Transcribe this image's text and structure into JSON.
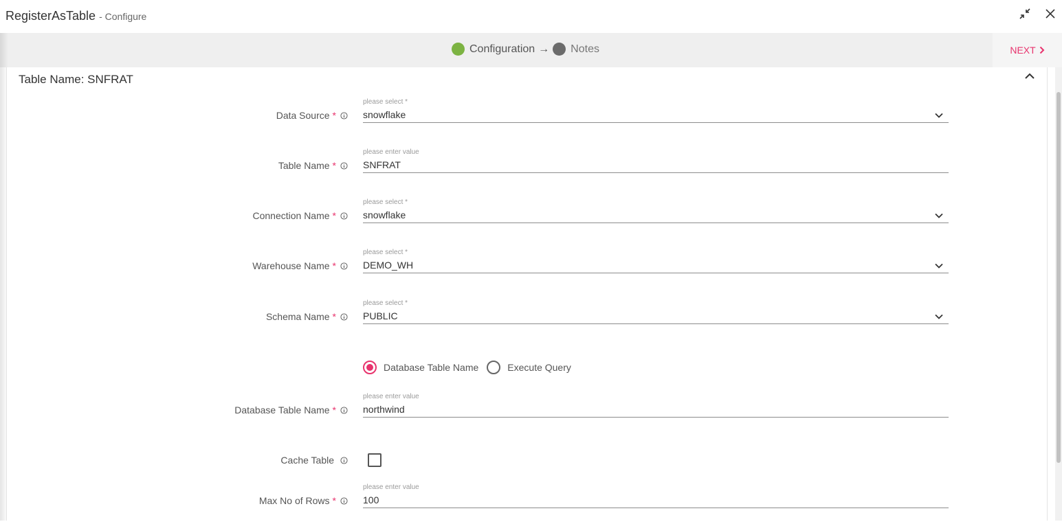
{
  "window": {
    "title": "RegisterAsTable",
    "subtitle": "- Configure"
  },
  "stepper": {
    "steps": [
      {
        "label": "Configuration",
        "status": "active",
        "color": "#7cb342"
      },
      {
        "label": "Notes",
        "status": "pending",
        "color": "#6b6b6b"
      }
    ],
    "arrow": "→",
    "next_label": "NEXT"
  },
  "panel": {
    "title": "Table Name: SNFRAT"
  },
  "form": {
    "data_source": {
      "label": "Data Source",
      "required": "*",
      "hint": "please select *",
      "value": "snowflake"
    },
    "table_name": {
      "label": "Table Name",
      "required": "*",
      "hint": "please enter value",
      "value": "SNFRAT"
    },
    "connection_name": {
      "label": "Connection Name",
      "required": "*",
      "hint": "please select *",
      "value": "snowflake"
    },
    "warehouse_name": {
      "label": "Warehouse Name",
      "required": "*",
      "hint": "please select *",
      "value": "DEMO_WH"
    },
    "schema_name": {
      "label": "Schema Name",
      "required": "*",
      "hint": "please select *",
      "value": "PUBLIC"
    },
    "source_type": {
      "options": [
        {
          "label": "Database Table Name",
          "selected": true
        },
        {
          "label": "Execute Query",
          "selected": false
        }
      ]
    },
    "database_table_name": {
      "label": "Database Table Name",
      "required": "*",
      "hint": "please enter value",
      "value": "northwind"
    },
    "cache_table": {
      "label": "Cache Table",
      "checked": false
    },
    "max_rows": {
      "label": "Max No of Rows",
      "required": "*",
      "hint": "please enter value",
      "value": "100"
    }
  },
  "colors": {
    "accent": "#e8336d",
    "success": "#7cb342"
  }
}
